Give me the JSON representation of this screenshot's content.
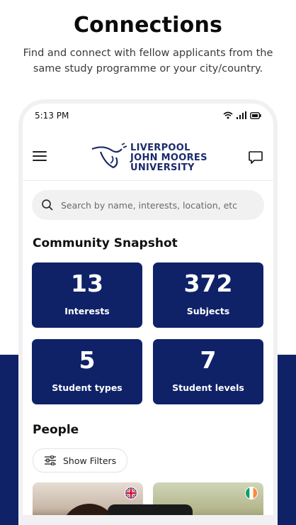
{
  "promo": {
    "title": "Connections",
    "subtitle": "Find and connect with fellow applicants from the same study programme or your city/country."
  },
  "status_bar": {
    "time": "5:13 PM"
  },
  "app_bar": {
    "logo_lines": [
      "LIVERPOOL",
      "JOHN MOORES",
      "UNIVERSITY"
    ]
  },
  "search": {
    "placeholder": "Search by name, interests, location, etc"
  },
  "snapshot": {
    "title": "Community Snapshot",
    "stats": [
      {
        "value": "13",
        "label": "Interests"
      },
      {
        "value": "372",
        "label": "Subjects"
      },
      {
        "value": "5",
        "label": "Student types"
      },
      {
        "value": "7",
        "label": "Student levels"
      }
    ]
  },
  "people": {
    "title": "People",
    "filters_label": "Show Filters",
    "cards": [
      {
        "flag": "uk-flag-icon"
      },
      {
        "flag": "ireland-flag-icon"
      }
    ]
  },
  "colors": {
    "brand_navy": "#0f2268",
    "logo_blue": "#1b2a6b"
  }
}
